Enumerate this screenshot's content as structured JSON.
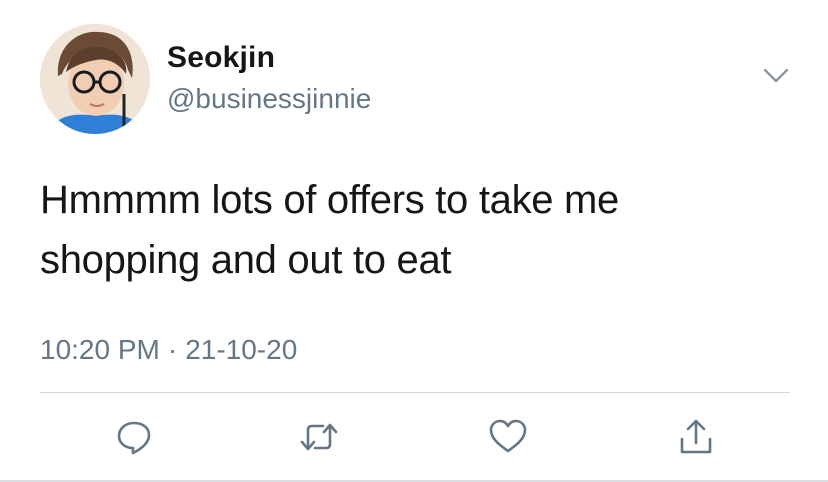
{
  "user": {
    "display_name": "Seokjin",
    "handle": "@businessjinnie",
    "avatar_icon": "profile-photo"
  },
  "tweet": {
    "text_line1": "Hmmmm lots of offers to take me",
    "text_line2": "shopping and out to eat",
    "time": "10:20 PM",
    "separator": "·",
    "date": "21-10-20"
  },
  "actions": {
    "reply_icon": "reply-icon",
    "retweet_icon": "retweet-icon",
    "like_icon": "heart-icon",
    "share_icon": "share-icon",
    "menu_icon": "chevron-down-icon"
  },
  "colors": {
    "text": "#14171a",
    "secondary": "#657786",
    "divider": "#ccd6dd"
  }
}
